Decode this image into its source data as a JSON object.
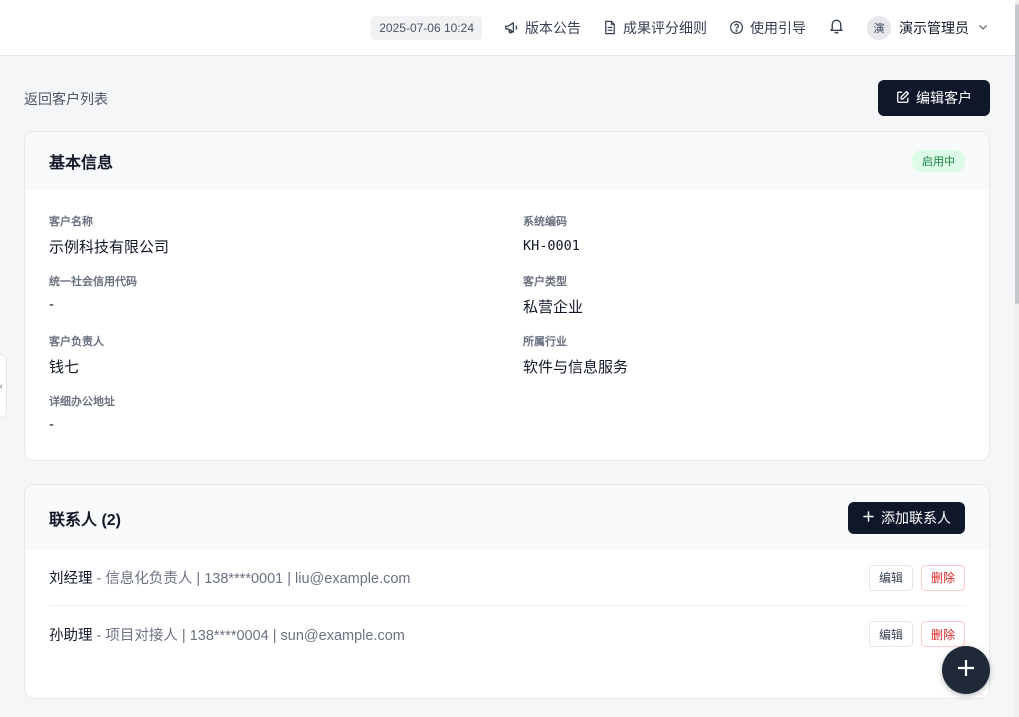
{
  "header": {
    "datetime": "2025-07-06 10:24",
    "links": [
      {
        "label": "版本公告",
        "icon": "megaphone-icon"
      },
      {
        "label": "成果评分细则",
        "icon": "document-icon"
      },
      {
        "label": "使用引导",
        "icon": "help-circle-icon"
      }
    ],
    "user": {
      "avatar_text": "演",
      "name": "演示管理员"
    }
  },
  "page": {
    "back_label": "返回客户列表",
    "edit_customer_label": "编辑客户"
  },
  "basic_info": {
    "title": "基本信息",
    "status": "启用中",
    "fields": [
      {
        "label": "客户名称",
        "value": "示例科技有限公司"
      },
      {
        "label": "系统编码",
        "value": "KH-0001"
      },
      {
        "label": "统一社会信用代码",
        "value": "-"
      },
      {
        "label": "客户类型",
        "value": "私营企业"
      },
      {
        "label": "客户负责人",
        "value": "钱七"
      },
      {
        "label": "所属行业",
        "value": "软件与信息服务"
      },
      {
        "label": "详细办公地址",
        "value": "-"
      }
    ]
  },
  "contacts": {
    "title": "联系人 (2)",
    "add_label": "添加联系人",
    "edit_label": "编辑",
    "delete_label": "删除",
    "items": [
      {
        "name": "刘经理",
        "detail": " - 信息化负责人 | 138****0001 | liu@example.com"
      },
      {
        "name": "孙助理",
        "detail": " - 项目对接人 | 138****0004 | sun@example.com"
      }
    ]
  },
  "colors": {
    "primary_dark": "#0f172a",
    "status_green": "#15803d",
    "danger": "#dc2626"
  }
}
